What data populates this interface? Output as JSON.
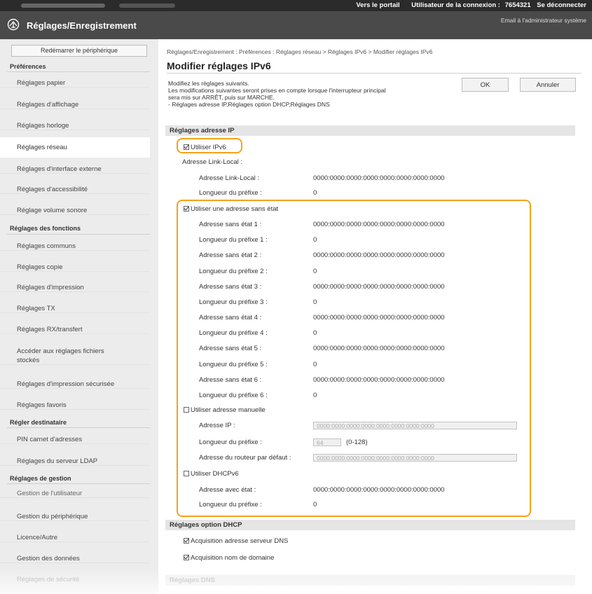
{
  "topbar": {
    "portal_link": "Vers le portail",
    "user_label": "Utilisateur de la connexion :",
    "user_id": "7654321",
    "logout_link": "Se déconnecter"
  },
  "header": {
    "title": "Réglages/Enregistrement",
    "admin_mail": "Email à l'administrateur système"
  },
  "sidebar": {
    "reboot_button": "Redémarrer le périphérique",
    "sections": {
      "preferences": "Préférences",
      "functions": "Réglages des fonctions",
      "destination": "Régler destinataire",
      "management": "Réglages de gestion"
    },
    "items": [
      "Réglages papier",
      "Réglages d'affichage",
      "Réglages horloge",
      "Réglages réseau",
      "Réglages d'interface externe",
      "Réglages d'accessibilité",
      "Réglage volume sonore",
      "Réglages communs",
      "Réglages copie",
      "Réglages d'impression",
      "Réglages TX",
      "Réglages RX/transfert",
      "Accéder aux réglages fichiers",
      "stockés",
      "Réglages d'impression sécurisée",
      "Réglages favoris",
      "PIN carnet d'adresses",
      "Réglages du serveur LDAP",
      "Gestion de l'utilisateur",
      "Gestion du périphérique",
      "Licence/Autre",
      "Gestion des données",
      "Réglages de sécurité"
    ]
  },
  "main": {
    "breadcrumb": "Réglages/Enregistrement : Préférences : Réglages réseau > Réglages IPv6 > Modifier réglages IPv6",
    "title": "Modifier réglages IPv6",
    "desc": [
      "Modifiez les réglages suivants.",
      "Les modifications suivantes seront prises en compte lorsque l'interrupteur principal",
      "sera mis sur ARRÊT, puis sur MARCHE.",
      "- Réglages adresse IP,Réglages option DHCP,Réglages DNS"
    ],
    "ok_button": "OK",
    "cancel_button": "Annuler",
    "ip_section": "Réglages adresse IP",
    "use_ipv6": "Utiliser IPv6",
    "link_local_title": "Adresse Link-Local :",
    "link_local_label": "Adresse Link-Local :",
    "link_local_value": "0000:0000:0000:0000:0000:0000:0000:0000",
    "prefix_label": "Longueur du préfixe :",
    "prefix_value": "0",
    "stateless_checkbox": "Utiliser une adresse sans état",
    "stateless": [
      {
        "addr_label": "Adresse sans état 1 :",
        "addr": "0000:0000:0000:0000:0000:0000:0000:0000",
        "pref_label": "Longueur du préfixe 1 :",
        "pref": "0"
      },
      {
        "addr_label": "Adresse sans état 2 :",
        "addr": "0000:0000:0000:0000:0000:0000:0000:0000",
        "pref_label": "Longueur du préfixe 2 :",
        "pref": "0"
      },
      {
        "addr_label": "Adresse sans état 3 :",
        "addr": "0000:0000:0000:0000:0000:0000:0000:0000",
        "pref_label": "Longueur du préfixe 3 :",
        "pref": "0"
      },
      {
        "addr_label": "Adresse sans état 4 :",
        "addr": "0000:0000:0000:0000:0000:0000:0000:0000",
        "pref_label": "Longueur du préfixe 4 :",
        "pref": "0"
      },
      {
        "addr_label": "Adresse sans état 5 :",
        "addr": "0000:0000:0000:0000:0000:0000:0000:0000",
        "pref_label": "Longueur du préfixe 5 :",
        "pref": "0"
      },
      {
        "addr_label": "Adresse sans état 6 :",
        "addr": "0000:0000:0000:0000:0000:0000:0000:0000",
        "pref_label": "Longueur du préfixe 6 :",
        "pref": "0"
      }
    ],
    "manual_checkbox": "Utiliser adresse manuelle",
    "manual_ip_label": "Adresse IP :",
    "manual_ip_value": "0000:0000:0000:0000:0000:0000:0000:0000",
    "manual_prefix_label": "Longueur du préfixe :",
    "manual_prefix_value": "64",
    "manual_prefix_range": "(0-128)",
    "gateway_label": "Adresse du routeur par défaut :",
    "gateway_value": "0000:0000:0000:0000:0000:0000:0000:0000",
    "dhcpv6_checkbox": "Utiliser DHCPv6",
    "stateful_label": "Adresse avec état :",
    "stateful_value": "0000:0000:0000:0000:0000:0000:0000:0000",
    "stateful_prefix_label": "Longueur du préfixe :",
    "stateful_prefix_value": "0",
    "dhcp_section": "Réglages option DHCP",
    "dns_server_acq": "Acquisition adresse serveur DNS",
    "domain_acq": "Acquisition nom de domaine",
    "dns_section": "Réglages DNS"
  },
  "colors": {
    "highlight": "#f5a21b",
    "header_bg": "#4a4a4a",
    "topbar_bg": "#2b2b2b"
  }
}
